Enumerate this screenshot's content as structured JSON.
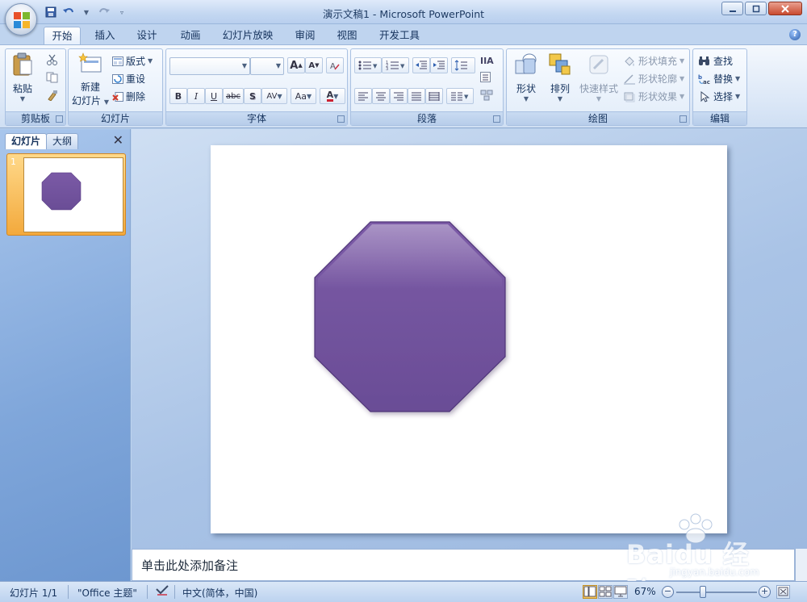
{
  "window": {
    "title": "演示文稿1 - Microsoft PowerPoint"
  },
  "tabs": [
    "开始",
    "插入",
    "设计",
    "动画",
    "幻灯片放映",
    "审阅",
    "视图",
    "开发工具"
  ],
  "ribbon": {
    "clipboard": {
      "group": "剪贴板",
      "paste": "粘贴"
    },
    "slides": {
      "group": "幻灯片",
      "new_slide_1": "新建",
      "new_slide_2": "幻灯片",
      "layout": "版式",
      "reset": "重设",
      "delete": "删除"
    },
    "font": {
      "group": "字体",
      "bold": "B",
      "italic": "I",
      "underline": "U",
      "strike": "abc",
      "shadow": "S",
      "spacing": "AV",
      "case": "Aa",
      "grow": "A",
      "shrink": "A"
    },
    "paragraph": {
      "group": "段落"
    },
    "drawing": {
      "group": "绘图",
      "shapes": "形状",
      "arrange": "排列",
      "quick_styles": "快速样式",
      "fill": "形状填充",
      "outline": "形状轮廓",
      "effects": "形状效果"
    },
    "editing": {
      "group": "编辑",
      "find": "查找",
      "replace": "替换",
      "select": "选择"
    }
  },
  "left_pane": {
    "tab_slides": "幻灯片",
    "tab_outline": "大纲",
    "slide_number": "1",
    "close": "✕"
  },
  "slide": {
    "shape_color": "#7b5aa6",
    "shape_color_dark": "#6a4d96",
    "shape": "octagon"
  },
  "notes": {
    "placeholder": "单击此处添加备注"
  },
  "status": {
    "slide_info": "幻灯片 1/1",
    "theme": "\"Office 主题\"",
    "language": "中文(简体，中国)",
    "zoom": "67%",
    "zoom_minus": "−",
    "zoom_plus": "+"
  },
  "watermark": {
    "brand": "Baidu 经验",
    "sub": "jingyan.baidu.com"
  }
}
